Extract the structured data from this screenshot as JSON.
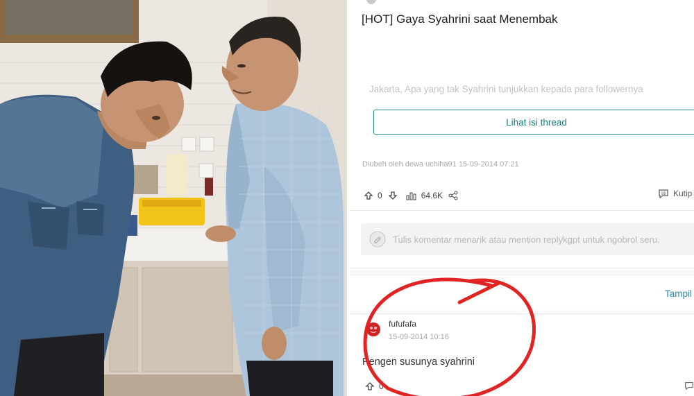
{
  "photo": {
    "description_icon": "photo-of-two-men"
  },
  "post": {
    "author_partial": "",
    "title": "[HOT] Gaya Syahrini saat Menembak",
    "excerpt": "Jakarta, Apa yang tak Syahrini tunjukkan kepada para followernya",
    "thread_button_label": "Lihat isi thread",
    "edit_note": "Diubeh oleh dewa uchiha91 15-09-2014 07:21",
    "upvotes": "0",
    "views": "64.6K",
    "quote_label": "Kutip"
  },
  "comment_input": {
    "placeholder": "Tulis komentar menarik atau mention replykgpt untuk ngobrol seru."
  },
  "sort": {
    "label": "Tampil"
  },
  "comment": {
    "username": "fufufafa",
    "timestamp": "15-09-2014 10:16",
    "body": "Pengen susunya syahrini",
    "upvotes": "0"
  },
  "colors": {
    "accent_teal": "#1d8e86",
    "annotation_red": "#e02424"
  }
}
